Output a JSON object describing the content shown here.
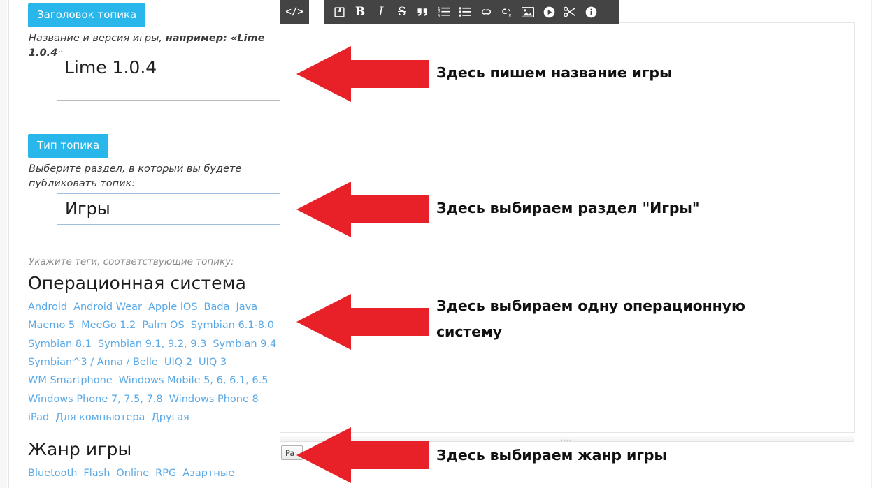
{
  "form": {
    "title_section": {
      "badge": "Заголовок топика",
      "hint_prefix": "Название и версия игры, ",
      "hint_bold": "например: «Lime 1.0.4»",
      "hint_suffix": ".",
      "input_value": "Lime 1.0.4",
      "input_placeholder": "Заголовок топика"
    },
    "type_section": {
      "badge": "Тип топика",
      "hint": "Выберите раздел, в который вы будете публиковать топик:",
      "select_value": "Игры",
      "select_options": [
        "Игры"
      ],
      "caret_icon": "chevron-down-icon"
    },
    "tags_hint": "Укажите теги, соответствующие топику:",
    "tag_groups": [
      {
        "heading": "Операционная система",
        "tags": [
          "Android",
          "Android Wear",
          "Apple iOS",
          "Bada",
          "Java",
          "Maemo 5",
          "MeeGo 1.2",
          "Palm OS",
          "Symbian 6.1-8.0",
          "Symbian 8.1",
          "Symbian 9.1, 9.2, 9.3",
          "Symbian 9.4",
          "Symbian^3 / Anna / Belle",
          "UIQ 2",
          "UIQ 3",
          "WM Smartphone",
          "Windows Mobile 5, 6, 6.1, 6.5",
          "Windows Phone 7, 7.5, 7.8",
          "Windows Phone 8",
          "iPad",
          "Для компьютера",
          "Другая"
        ]
      },
      {
        "heading": "Жанр игры",
        "tags": [
          "Bluetooth",
          "Flash",
          "Online",
          "RPG",
          "Азартные"
        ]
      }
    ]
  },
  "editor": {
    "source_tab_label": "</>",
    "source_tab_icon": "code-icon",
    "toolbar_buttons": [
      {
        "icon": "save-icon",
        "label": "Сохранить"
      },
      {
        "icon": "bold-icon",
        "label": "B"
      },
      {
        "icon": "italic-icon",
        "label": "I"
      },
      {
        "icon": "strikethrough-icon",
        "label": "S"
      },
      {
        "icon": "quote-icon",
        "label": "Цитата"
      },
      {
        "icon": "ordered-list-icon",
        "label": "Нумерованный список"
      },
      {
        "icon": "bullet-list-icon",
        "label": "Маркированный список"
      },
      {
        "icon": "link-icon",
        "label": "Ссылка"
      },
      {
        "icon": "unlink-icon",
        "label": "Убрать ссылку"
      },
      {
        "icon": "image-icon",
        "label": "Изображение"
      },
      {
        "icon": "video-icon",
        "label": "Видео"
      },
      {
        "icon": "cut-icon",
        "label": "Кат"
      },
      {
        "icon": "info-icon",
        "label": "Информация"
      }
    ],
    "content": "",
    "path_button_label": "Pa",
    "resize_handle_icon": "resize-grip-icon",
    "resize_handle_glyph": "....",
    "colors": {
      "toolbar_bg": "#444444",
      "panel_border": "#e4e4e4"
    }
  },
  "annotations": {
    "arrow_color": "#e82128",
    "arrow_icon": "arrow-left-icon",
    "items": [
      {
        "text": "Здесь пишем название игры"
      },
      {
        "text": "Здесь выбираем раздел \"Игры\""
      },
      {
        "text": "Здесь выбираем одну операционную"
      },
      {
        "text": "систему"
      },
      {
        "text": "Здесь выбираем жанр игры"
      }
    ]
  },
  "theme": {
    "badge_blue": "#29b6ea",
    "tag_blue": "#5aa9e6",
    "text_dark": "#1d1d1d"
  }
}
